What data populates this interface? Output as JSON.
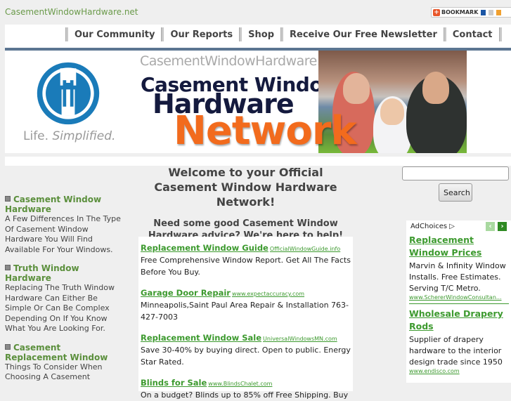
{
  "header": {
    "site_title": "CasementWindowHardware.net",
    "bookmark_label": "BOOKMARK"
  },
  "nav": {
    "items": [
      "Our Community",
      "Our Reports",
      "Shop",
      "Receive Our Free Newsletter",
      "Contact"
    ]
  },
  "banner": {
    "tagline_a": "Life.",
    "tagline_b": "Simplified.",
    "domain": "CasementWindowHardware.net",
    "line1": "Casement Window",
    "line2": "Hardware",
    "line3": "Network",
    "logo_color": "#1a7bb9"
  },
  "left_articles": [
    {
      "title": "Casement Window Hardware",
      "desc": "A Few Differences In The Type Of Casement Window Hardware You Will Find Available For Your Windows."
    },
    {
      "title": "Truth Window Hardware",
      "desc": "Replacing The Truth Window Hardware Can Either Be Simple Or Can Be Complex Depending On If You Know What You Are Looking For."
    },
    {
      "title": "Casement Replacement Window",
      "desc": "Things To Consider When Choosing A Casement"
    }
  ],
  "center": {
    "welcome": "Welcome to your Official Casement Window Hardware Network!",
    "subheading": "Need some good Casement Window Hardware advice? We're here to help!"
  },
  "center_ads": [
    {
      "title": "Replacement Window Guide",
      "url": "OfficialWindowGuide.info",
      "desc": "Free Comprehensive Window Report. Get All The Facts Before You Buy."
    },
    {
      "title": "Garage Door Repair",
      "url": "www.expectaccuracy.com",
      "desc": "Minneapolis,Saint Paul Area Repair & Installation 763-427-7003"
    },
    {
      "title": "Replacement Window Sale",
      "url": "UniversalWindowsMN.com",
      "desc": "Save 30-40% by buying direct. Open to public. Energy Star Rated."
    },
    {
      "title": "Blinds for Sale",
      "url": "www.BlindsChalet.com",
      "desc": "On a budget? Blinds up to 85% off Free Shipping. Buy"
    }
  ],
  "search": {
    "value": "",
    "button_label": "Search"
  },
  "right_ads": {
    "adchoices_label": "AdChoices",
    "prev_icon": "‹",
    "next_icon": "›",
    "items": [
      {
        "title": "Replacement Window Prices",
        "desc": "Marvin & Infinity Window Installs. Free Estimates. Serving T/C Metro.",
        "url": "www.SchererWindowConsultan..."
      },
      {
        "title": "Wholesale Drapery Rods",
        "desc": "Supplier of drapery hardware to the interior design trade since 1950",
        "url": "www.endisco.com"
      }
    ]
  },
  "colors": {
    "link_green": "#3d9a2f",
    "article_green": "#5b8f3c",
    "nav_rule": "#5b7591",
    "network_orange": "#f26b1d"
  }
}
